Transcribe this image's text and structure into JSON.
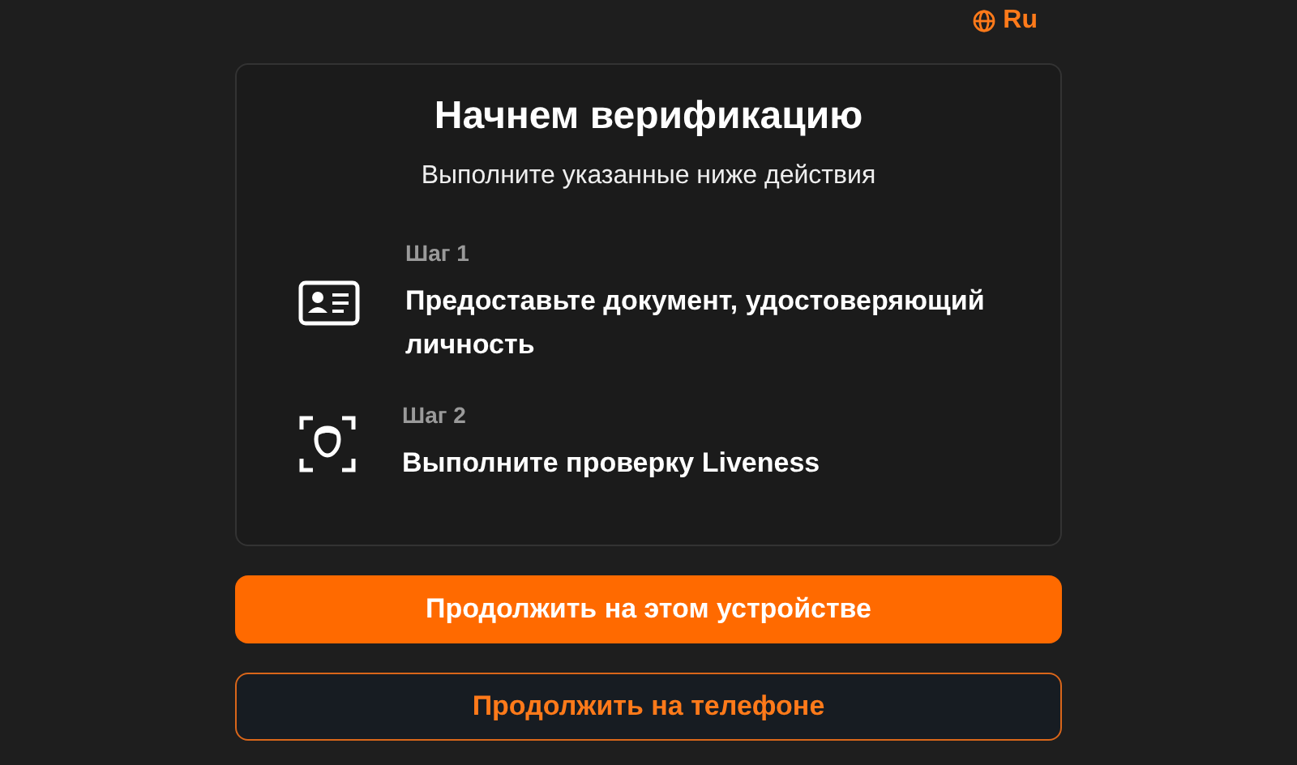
{
  "language": {
    "label": "Ru"
  },
  "card": {
    "title": "Начнем верификацию",
    "subtitle": "Выполните указанные ниже действия",
    "steps": [
      {
        "kind": "id-card",
        "label": "Шаг 1",
        "text": "Предоставьте документ, удостоверяющий личность"
      },
      {
        "kind": "face-scan",
        "label": "Шаг 2",
        "text": "Выполните проверку Liveness"
      }
    ]
  },
  "buttons": [
    {
      "kind": "primary",
      "label": "Продолжить на этом устройстве"
    },
    {
      "kind": "secondary",
      "label": "Продолжить на телефоне"
    }
  ]
}
